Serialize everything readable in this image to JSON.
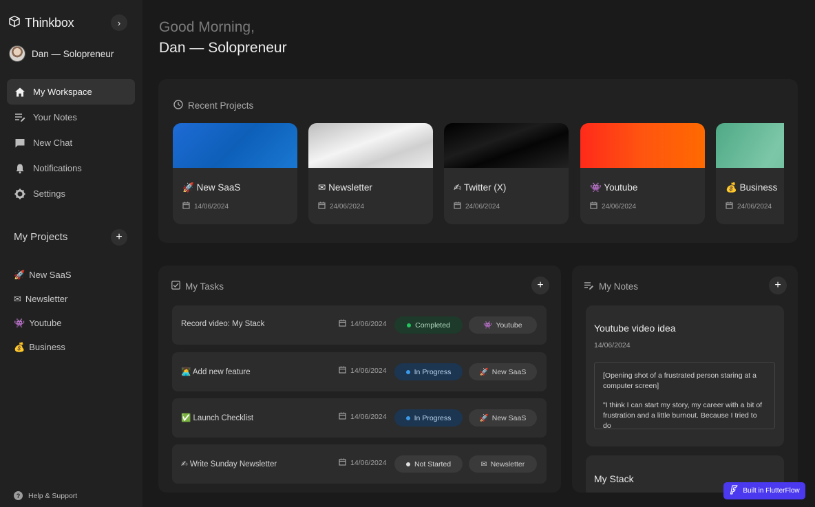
{
  "app": {
    "name": "Thinkbox"
  },
  "user": {
    "name": "Dan — Solopreneur"
  },
  "nav": {
    "items": [
      {
        "label": "My Workspace",
        "icon": "home-icon",
        "active": true
      },
      {
        "label": "Your Notes",
        "icon": "notes-icon"
      },
      {
        "label": "New Chat",
        "icon": "chat-icon"
      },
      {
        "label": "Notifications",
        "icon": "bell-icon"
      },
      {
        "label": "Settings",
        "icon": "gear-icon"
      }
    ]
  },
  "sidebar_projects": {
    "title": "My Projects",
    "items": [
      {
        "emoji": "🚀",
        "label": "New SaaS"
      },
      {
        "emoji": "✉",
        "label": "Newsletter"
      },
      {
        "emoji": "👾",
        "label": "Youtube"
      },
      {
        "emoji": "💰",
        "label": "Business"
      }
    ]
  },
  "help": {
    "label": "Help & Support"
  },
  "greeting": {
    "line1": "Good Morning,",
    "line2": "Dan — Solopreneur"
  },
  "recent": {
    "title": "Recent Projects",
    "cards": [
      {
        "emoji": "🚀",
        "title": "New SaaS",
        "date": "14/06/2024",
        "color": "#1a6fd0"
      },
      {
        "emoji": "✉",
        "title": "Newsletter",
        "date": "24/06/2024",
        "color": "#dcdcdc"
      },
      {
        "emoji": "✍",
        "title": "Twitter (X)",
        "date": "24/06/2024",
        "color": "#0a0a0a"
      },
      {
        "emoji": "👾",
        "title": "Youtube",
        "date": "24/06/2024",
        "color": "#ff4a12"
      },
      {
        "emoji": "💰",
        "title": "Business",
        "date": "24/06/2024",
        "color": "#5fb492"
      }
    ]
  },
  "tasks": {
    "title": "My Tasks",
    "items": [
      {
        "emoji": "",
        "name": "Record video: My Stack",
        "date": "14/06/2024",
        "status": "Completed",
        "status_color": "#22c55e",
        "tag_emoji": "👾",
        "tag": "Youtube"
      },
      {
        "emoji": "👩‍💻",
        "name": "Add new feature",
        "date": "14/06/2024",
        "status": "In Progress",
        "status_color": "#3b9ae8",
        "tag_emoji": "🚀",
        "tag": "New SaaS"
      },
      {
        "emoji": "✅",
        "name": "Launch Checklist",
        "date": "14/06/2024",
        "status": "In Progress",
        "status_color": "#3b9ae8",
        "tag_emoji": "🚀",
        "tag": "New SaaS"
      },
      {
        "emoji": "✍",
        "name": "Write Sunday Newsletter",
        "date": "14/06/2024",
        "status": "Not Started",
        "status_color": "#e0e0e0",
        "tag_emoji": "✉",
        "tag": "Newsletter"
      }
    ]
  },
  "notes": {
    "title": "My Notes",
    "items": [
      {
        "title": "Youtube video idea",
        "date": "14/06/2024",
        "body1": "[Opening shot of a frustrated person staring at a computer screen]",
        "body2": "\"I think I can start my story, my career with a bit of frustration and a little burnout. Because I tried to do"
      },
      {
        "title": "My Stack"
      }
    ]
  },
  "badge": {
    "label": "Built in FlutterFlow"
  }
}
